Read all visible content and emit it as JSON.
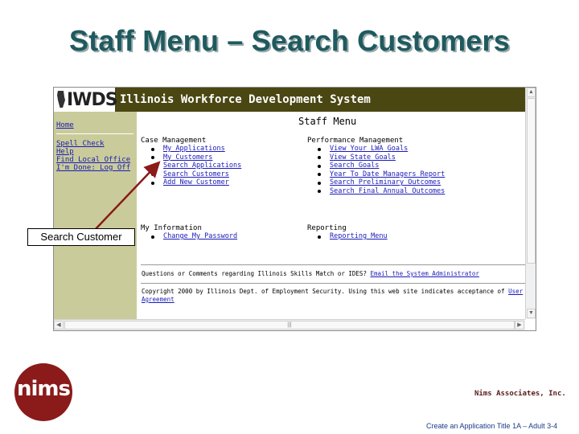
{
  "slide": {
    "title": "Staff Menu – Search Customers",
    "footer": "Create an Application Title 1A – Adult 3-4",
    "company": "Nims Associates, Inc.",
    "logo_text": "nims",
    "callout": "Search Customer"
  },
  "browser": {
    "banner": {
      "logo_text": "IWDS",
      "title": "Illinois Workforce Development System"
    },
    "sidebar": {
      "home": "Home",
      "links": [
        "Spell Check",
        "Help",
        "Find Local Office",
        "I'm Done: Log Off"
      ]
    },
    "page_heading": "Staff Menu",
    "case_management": {
      "heading": "Case Management",
      "items": [
        "My Applications",
        "My Customers",
        "Search Applications",
        "Search Customers",
        "Add New Customer"
      ]
    },
    "performance_management": {
      "heading": "Performance Management",
      "items": [
        "View Your LWA Goals",
        "View State Goals",
        "Search Goals",
        "Year To Date Managers Report",
        "Search Preliminary Outcomes",
        "Search Final Annual Outcomes"
      ]
    },
    "my_information": {
      "heading": "My Information",
      "items": [
        "Change My Password"
      ]
    },
    "reporting": {
      "heading": "Reporting",
      "items": [
        "Reporting Menu"
      ]
    },
    "footer": {
      "questions": "Questions or Comments regarding Illinois Skills Match or IDES?",
      "email_link": "Email the System Administrator",
      "copyright": "Copyright 2000 by Illinois Dept. of Employment Security. Using this web site indicates acceptance of",
      "user_link": "User",
      "agreement_link": "Agreement"
    }
  },
  "colors": {
    "title": "#1f5a5e",
    "banner": "#4a4713",
    "sidebar": "#c9cc9a",
    "link": "#1a1ab8",
    "arrow": "#8b1a1a",
    "logo": "#8b1a1a"
  }
}
